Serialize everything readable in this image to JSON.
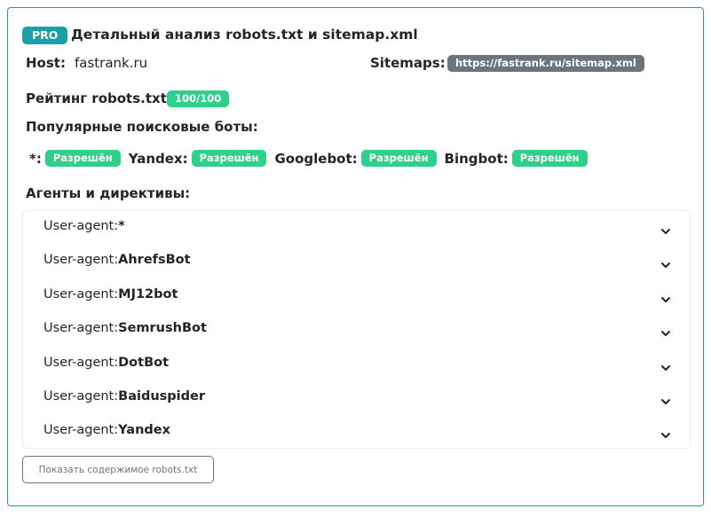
{
  "header": {
    "pro_badge": "PRO",
    "title": "Детальный анализ robots.txt и sitemap.xml"
  },
  "host": {
    "label": "Host:",
    "value": "fastrank.ru"
  },
  "sitemaps": {
    "label": "Sitemaps:",
    "value": "https://fastrank.ru/sitemap.xml"
  },
  "rating": {
    "label": "Рейтинг robots.txt:",
    "value": "100/100"
  },
  "bots": {
    "title": "Популярные поисковые боты:",
    "items": [
      {
        "name": "*:",
        "status": "Разрешён"
      },
      {
        "name": "Yandex:",
        "status": "Разрешён"
      },
      {
        "name": "Googlebot:",
        "status": "Разрешён"
      },
      {
        "name": "Bingbot:",
        "status": "Разрешён"
      }
    ]
  },
  "agents": {
    "title": "Агенты и директивы:",
    "prefix": "User-agent:",
    "items": [
      {
        "name": "*"
      },
      {
        "name": "AhrefsBot"
      },
      {
        "name": "MJ12bot"
      },
      {
        "name": "SemrushBot"
      },
      {
        "name": "DotBot"
      },
      {
        "name": "Baiduspider"
      },
      {
        "name": "Yandex"
      }
    ]
  },
  "show_button": "Показать содержимое robots.txt",
  "colors": {
    "accent": "#1aa0a8",
    "success": "#2fd08a",
    "grey_badge": "#6c757d"
  }
}
